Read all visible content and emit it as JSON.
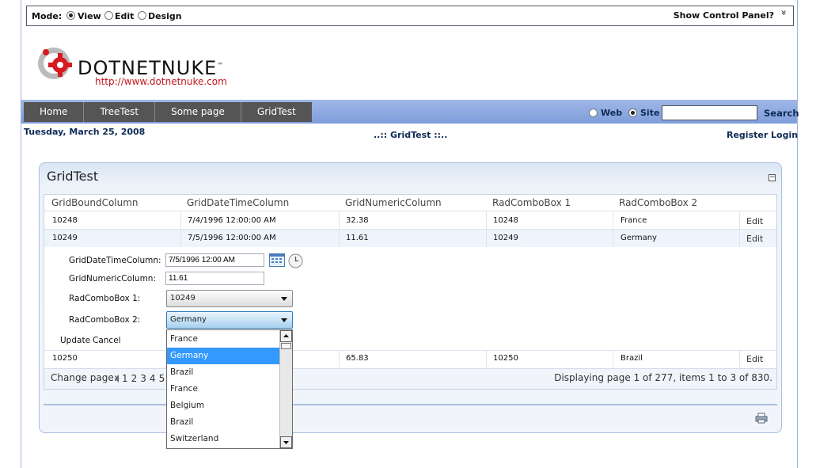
{
  "control_panel": {
    "mode_label": "Mode:",
    "modes": [
      {
        "label": "View",
        "selected": true
      },
      {
        "label": "Edit",
        "selected": false
      },
      {
        "label": "Design",
        "selected": false
      }
    ],
    "show_panel": "Show Control Panel?",
    "chevron": "»"
  },
  "logo": {
    "name": "DOTNETNUKE",
    "tm": "™",
    "url": "http://www.dotnetnuke.com"
  },
  "menu": [
    "Home",
    "TreeTest",
    "Some page",
    "GridTest"
  ],
  "search": {
    "scopes": [
      {
        "label": "Web",
        "selected": false
      },
      {
        "label": "Site",
        "selected": true
      }
    ],
    "button": "Search",
    "value": ""
  },
  "date": "Tuesday, March 25, 2008",
  "breadcrumb": "..:: GridTest ::..",
  "register": "Register",
  "login": "Login",
  "module": {
    "title": "GridTest",
    "minimize": "−"
  },
  "grid": {
    "columns": [
      "GridBoundColumn",
      "GridDateTimeColumn",
      "GridNumericColumn",
      "RadComboBox 1",
      "RadComboBox 2"
    ],
    "rows": [
      {
        "c1": "10248",
        "c2": "7/4/1996 12:00:00 AM",
        "c3": "32.38",
        "c4": "10248",
        "c5": "France",
        "action": "Edit"
      },
      {
        "c1": "10249",
        "c2": "7/5/1996 12:00:00 AM",
        "c3": "11.61",
        "c4": "10249",
        "c5": "Germany",
        "action": "Edit"
      },
      {
        "c1": "10250",
        "c2": "",
        "c3": "65.83",
        "c4": "10250",
        "c5": "Brazil",
        "action": "Edit"
      }
    ],
    "edit_form": {
      "datetime_label": "GridDateTimeColumn:",
      "datetime_value": "7/5/1996 12:00 AM",
      "numeric_label": "GridNumericColumn:",
      "numeric_value": "11.61",
      "combo1_label": "RadComboBox 1:",
      "combo1_value": "10249",
      "combo2_label": "RadComboBox 2:",
      "combo2_value": "Germany",
      "update": "Update",
      "cancel": "Cancel"
    },
    "dropdown_items": [
      "France",
      "Germany",
      "Brazil",
      "France",
      "Belgium",
      "Brazil",
      "Switzerland"
    ],
    "dropdown_selected_index": 1,
    "pager": {
      "label": "Change page:",
      "pages": [
        "1",
        "2",
        "3",
        "4",
        "5"
      ],
      "status": "Displaying page 1 of 277, items 1 to 3 of 830."
    }
  }
}
